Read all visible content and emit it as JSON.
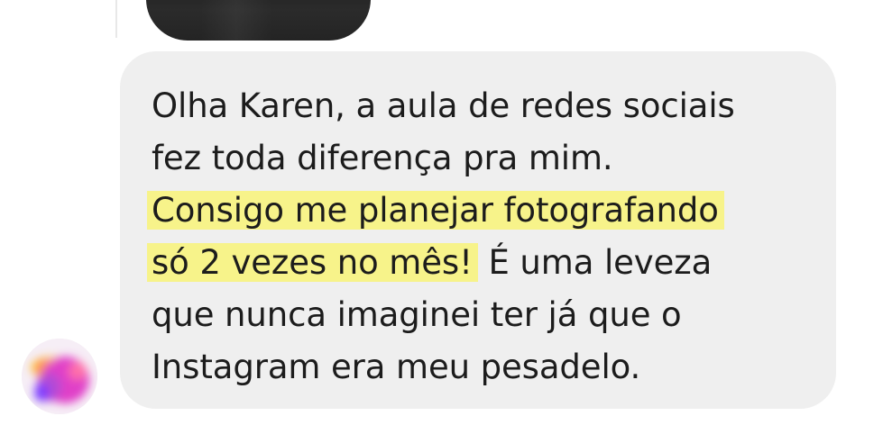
{
  "message": {
    "text_before": "Olha Karen, a aula de redes sociais\nfez toda diferença pra mim.\n",
    "highlighted_text": "Consigo me planejar fotografando\nsó 2 vezes no mês!",
    "text_after": " É uma leveza\nque nunca imaginei ter já que o\nInstagram era meu pesadelo.",
    "bubble_color": "#efefef",
    "highlight_color": "#f7f38a"
  },
  "avatar": {
    "style": "blurred",
    "colors": [
      "#e040c8",
      "#ff6fa8",
      "#ffd23f",
      "#7d3cff"
    ]
  }
}
